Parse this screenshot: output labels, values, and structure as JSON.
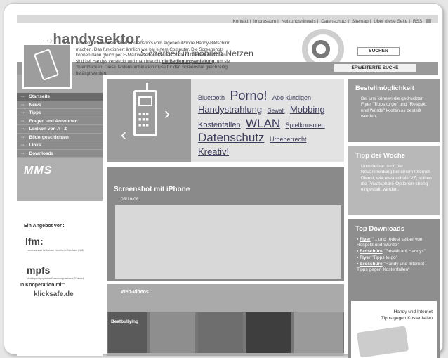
{
  "topnav": {
    "links": [
      "Kontakt",
      "Impressum",
      "Nutzungshinweis",
      "Datenschutz",
      "Sitemap",
      "Über diese Seite",
      "RSS"
    ]
  },
  "header": {
    "logo": "handysektor",
    "slogan": "Sicherheit in mobilen Netzen",
    "search_button": "SUCHEN",
    "advanced_search": "ERWEITERTE SUCHE"
  },
  "sidebar": {
    "nav": [
      "Startseite",
      "News",
      "Tipps",
      "Fragen und Antworten",
      "Lexikon von A - Z",
      "Bildergeschichten",
      "Links",
      "Downloads"
    ],
    "mms_banner": "MMS",
    "offer_label": "Ein Angebot von:",
    "partner1": "lfm:",
    "partner1_sub": "Landesanstalt für Medien Nordrhein-Westfalen (LfM)",
    "partner2": "mpfs",
    "partner2_sub": "Medienpädagogischer Forschungsverbund Südwest",
    "coop_label": "In Kooperation mit:",
    "coop_partner": "klicksafe.de"
  },
  "tagcloud": [
    "Bluetooth",
    "Porno!",
    "Abo kündigen",
    "Handystrahlung",
    "Gewalt",
    "Mobbing",
    "Kostenfallen",
    "WLAN",
    "Spielkonsolen",
    "Datenschutz",
    "Urheberrecht",
    "Kreativ!"
  ],
  "article": {
    "title": "Screenshot mit iPhone",
    "date": "05/10/08",
    "text1": "Mit dem iPhone kann man Screenshots vom eigenen iPhone Handy-Bildschirm machen. Das funktioniert ähnlich wie bei einem Computer. Die Screenshots können dann gleich per E-Mail versendet werden. Viele nützliche Funktionen sind bei Handys versteckt und man braucht ",
    "link": "die Bedienungsanleitung",
    "text2": ", um sie zu entdecken. Diese Tastenkombination muss für den Screenshot gleichzeitig betätigt werden:"
  },
  "webvideos": {
    "title": "Web-Videos",
    "first_label": "Beatbullying"
  },
  "right": {
    "bestell_title": "Bestellmöglichkeit",
    "bestell_text": "Bei uns können die gedruckten Flyer \"Tipps to go\" und \"Respekt und Würde\" kostenlos bestellt werden.",
    "tipp_title": "Tipp der Woche",
    "tipp_text": "Unmittelbar nach der Neuanmeldung bei einem Internet-Dienst, wie etwa schülerVZ, sollten die Privatsphäre-Optionen streng eingestellt werden.",
    "downloads_title": "Top Downloads",
    "downloads": [
      {
        "type": "Flyer",
        "text": " \"... und redest selber von Respekt und Würde\""
      },
      {
        "type": "Broschüre",
        "text": " \"Gewalt auf Handys\""
      },
      {
        "type": "Flyer",
        "text": " \"Tipps to go\""
      },
      {
        "type": "Broschüre",
        "text": " \"Handy und Internet - Tipps gegen Kostenfallen\""
      }
    ],
    "brochure_line1": "Handy und Internet",
    "brochure_line2": "Tipps gegen Kostenfallen"
  }
}
